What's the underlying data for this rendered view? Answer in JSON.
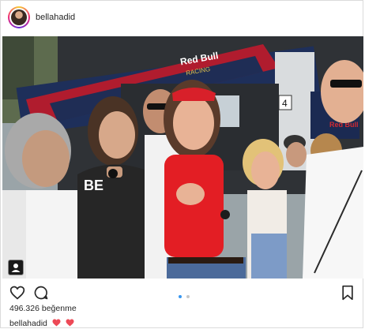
{
  "post": {
    "username": "bellahadid",
    "likes_text": "496.326 beğenme",
    "caption_user": "bellahadid",
    "caption_emojis": [
      "heart-emoji",
      "heart-emoji"
    ],
    "carousel": {
      "count": 2,
      "active": 1
    },
    "photo_signage": {
      "sign_1": "Red Bull",
      "sign_2": "RACING",
      "sign_3": "Red Bull",
      "sign_4": "4",
      "sign_5": "BE"
    }
  },
  "icons": {
    "like": "heart-outline-icon",
    "comment": "comment-bubble-icon",
    "save": "bookmark-icon",
    "tag": "user-tag-icon"
  },
  "colors": {
    "accent": "#3897f0",
    "text": "#262626",
    "border": "#dbdbdb",
    "heart_red": "#ed4956"
  }
}
